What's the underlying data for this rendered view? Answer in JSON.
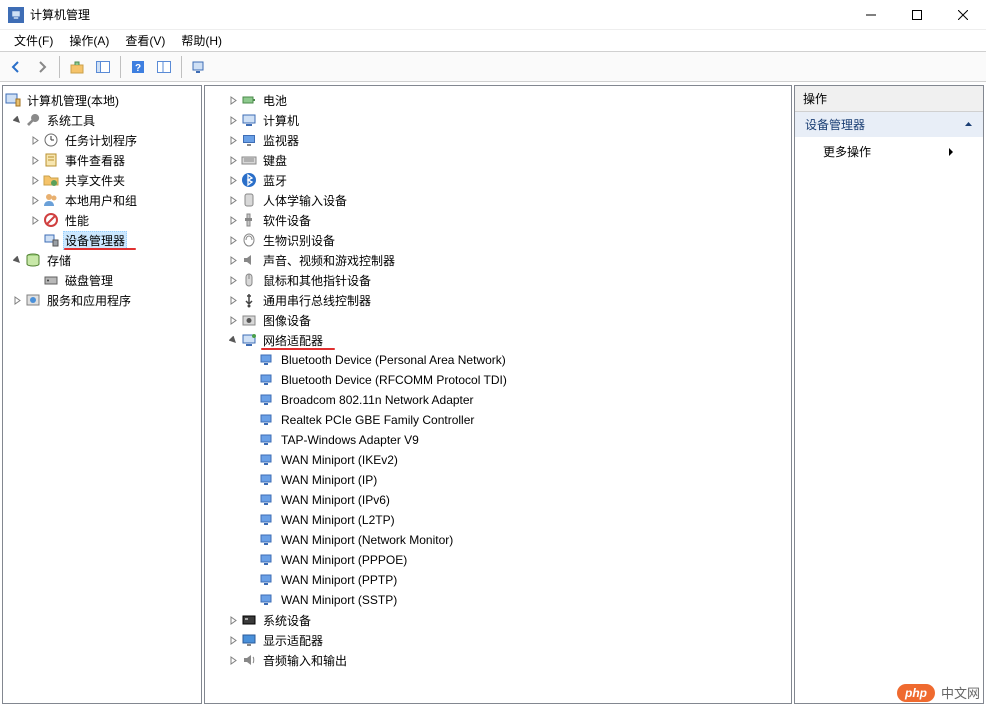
{
  "window": {
    "title": "计算机管理"
  },
  "menu": {
    "file": "文件(F)",
    "action": "操作(A)",
    "view": "查看(V)",
    "help": "帮助(H)"
  },
  "left_tree": {
    "root": "计算机管理(本地)",
    "system_tools": "系统工具",
    "task_scheduler": "任务计划程序",
    "event_viewer": "事件查看器",
    "shared_folders": "共享文件夹",
    "local_users": "本地用户和组",
    "performance": "性能",
    "device_manager": "设备管理器",
    "storage": "存储",
    "disk_management": "磁盘管理",
    "services_apps": "服务和应用程序"
  },
  "device_tree": {
    "battery": "电池",
    "computer": "计算机",
    "monitor": "监视器",
    "keyboard": "键盘",
    "bluetooth": "蓝牙",
    "hid": "人体学输入设备",
    "software_devices": "软件设备",
    "biometric": "生物识别设备",
    "audio_video_game": "声音、视频和游戏控制器",
    "mouse_pointer": "鼠标和其他指针设备",
    "usb": "通用串行总线控制器",
    "imaging": "图像设备",
    "network_adapters": "网络适配器",
    "net_items": [
      "Bluetooth Device (Personal Area Network)",
      "Bluetooth Device (RFCOMM Protocol TDI)",
      "Broadcom 802.11n Network Adapter",
      "Realtek PCIe GBE Family Controller",
      "TAP-Windows Adapter V9",
      "WAN Miniport (IKEv2)",
      "WAN Miniport (IP)",
      "WAN Miniport (IPv6)",
      "WAN Miniport (L2TP)",
      "WAN Miniport (Network Monitor)",
      "WAN Miniport (PPPOE)",
      "WAN Miniport (PPTP)",
      "WAN Miniport (SSTP)"
    ],
    "system_devices": "系统设备",
    "display_adapters": "显示适配器",
    "audio_io": "音频输入和输出"
  },
  "actions_pane": {
    "header": "操作",
    "section": "设备管理器",
    "more_actions": "更多操作"
  },
  "watermark": {
    "badge": "php",
    "text": "中文网"
  }
}
